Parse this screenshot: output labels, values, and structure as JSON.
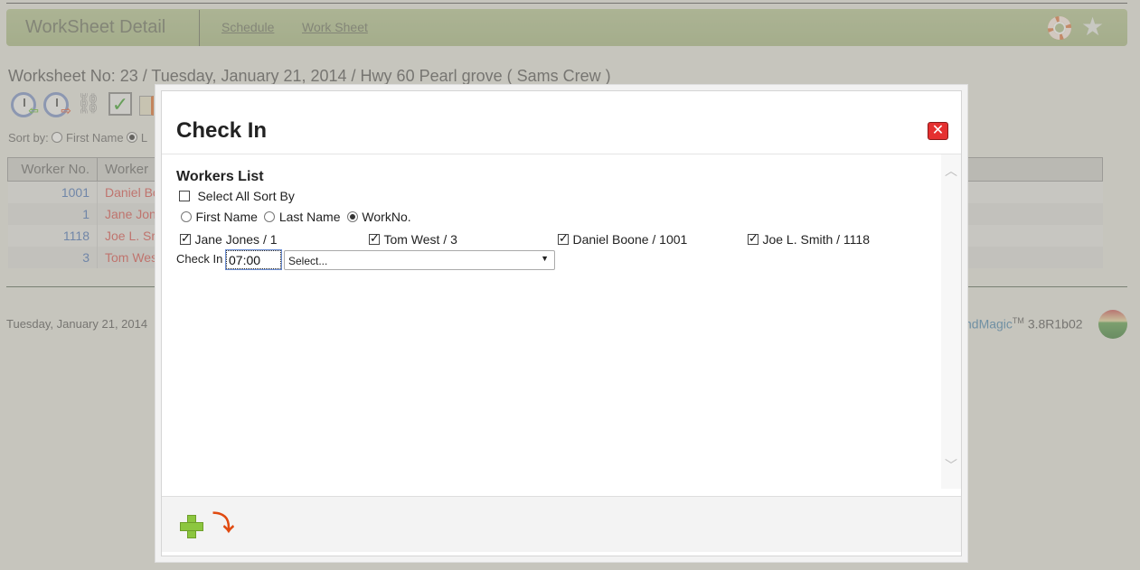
{
  "header": {
    "title": "WorkSheet Detail",
    "links": [
      "Schedule",
      "Work Sheet"
    ],
    "icons": [
      "lifebuoy-icon",
      "star-icon"
    ]
  },
  "worksheet": {
    "info": "Worksheet No: 23 / Tuesday, January 21, 2014 / Hwy 60 Pearl grove ( Sams Crew )",
    "toolbar_icons": [
      "clock-in-icon",
      "clock-out-icon",
      "unlink-icon",
      "checkbox-icon",
      "ticket-icon"
    ],
    "sort_by_label": "Sort by:",
    "sort_options": [
      {
        "label": "First Name",
        "selected": false
      },
      {
        "label": "L",
        "selected": true
      }
    ]
  },
  "table": {
    "headers": [
      "Worker No.",
      "Worker"
    ],
    "rows": [
      {
        "no": "1001",
        "name": "Daniel Bo"
      },
      {
        "no": "1",
        "name": "Jane Jon"
      },
      {
        "no": "1118",
        "name": "Joe L. Sr"
      },
      {
        "no": "3",
        "name": "Tom Wes"
      }
    ]
  },
  "footer": {
    "date": "Tuesday, January 21, 2014",
    "brand": "ndMagic",
    "tm": "TM",
    "version": "3.8R1b02"
  },
  "modal": {
    "title": "Check In",
    "section_title": "Workers List",
    "select_all_label": "Select All Sort By",
    "select_all_checked": false,
    "sort_options": [
      {
        "label": "First Name",
        "selected": false
      },
      {
        "label": "Last Name",
        "selected": false
      },
      {
        "label": "WorkNo.",
        "selected": true
      }
    ],
    "workers": [
      {
        "label": "Jane Jones / 1",
        "checked": true
      },
      {
        "label": "Tom West / 3",
        "checked": true
      },
      {
        "label": "Daniel Boone / 1001",
        "checked": true
      },
      {
        "label": "Joe L. Smith / 1118",
        "checked": true
      }
    ],
    "check_in_label": "Check In",
    "check_in_time": "07:00",
    "select_value": "Select...",
    "footer_icons": [
      "add-icon",
      "undo-icon"
    ]
  }
}
